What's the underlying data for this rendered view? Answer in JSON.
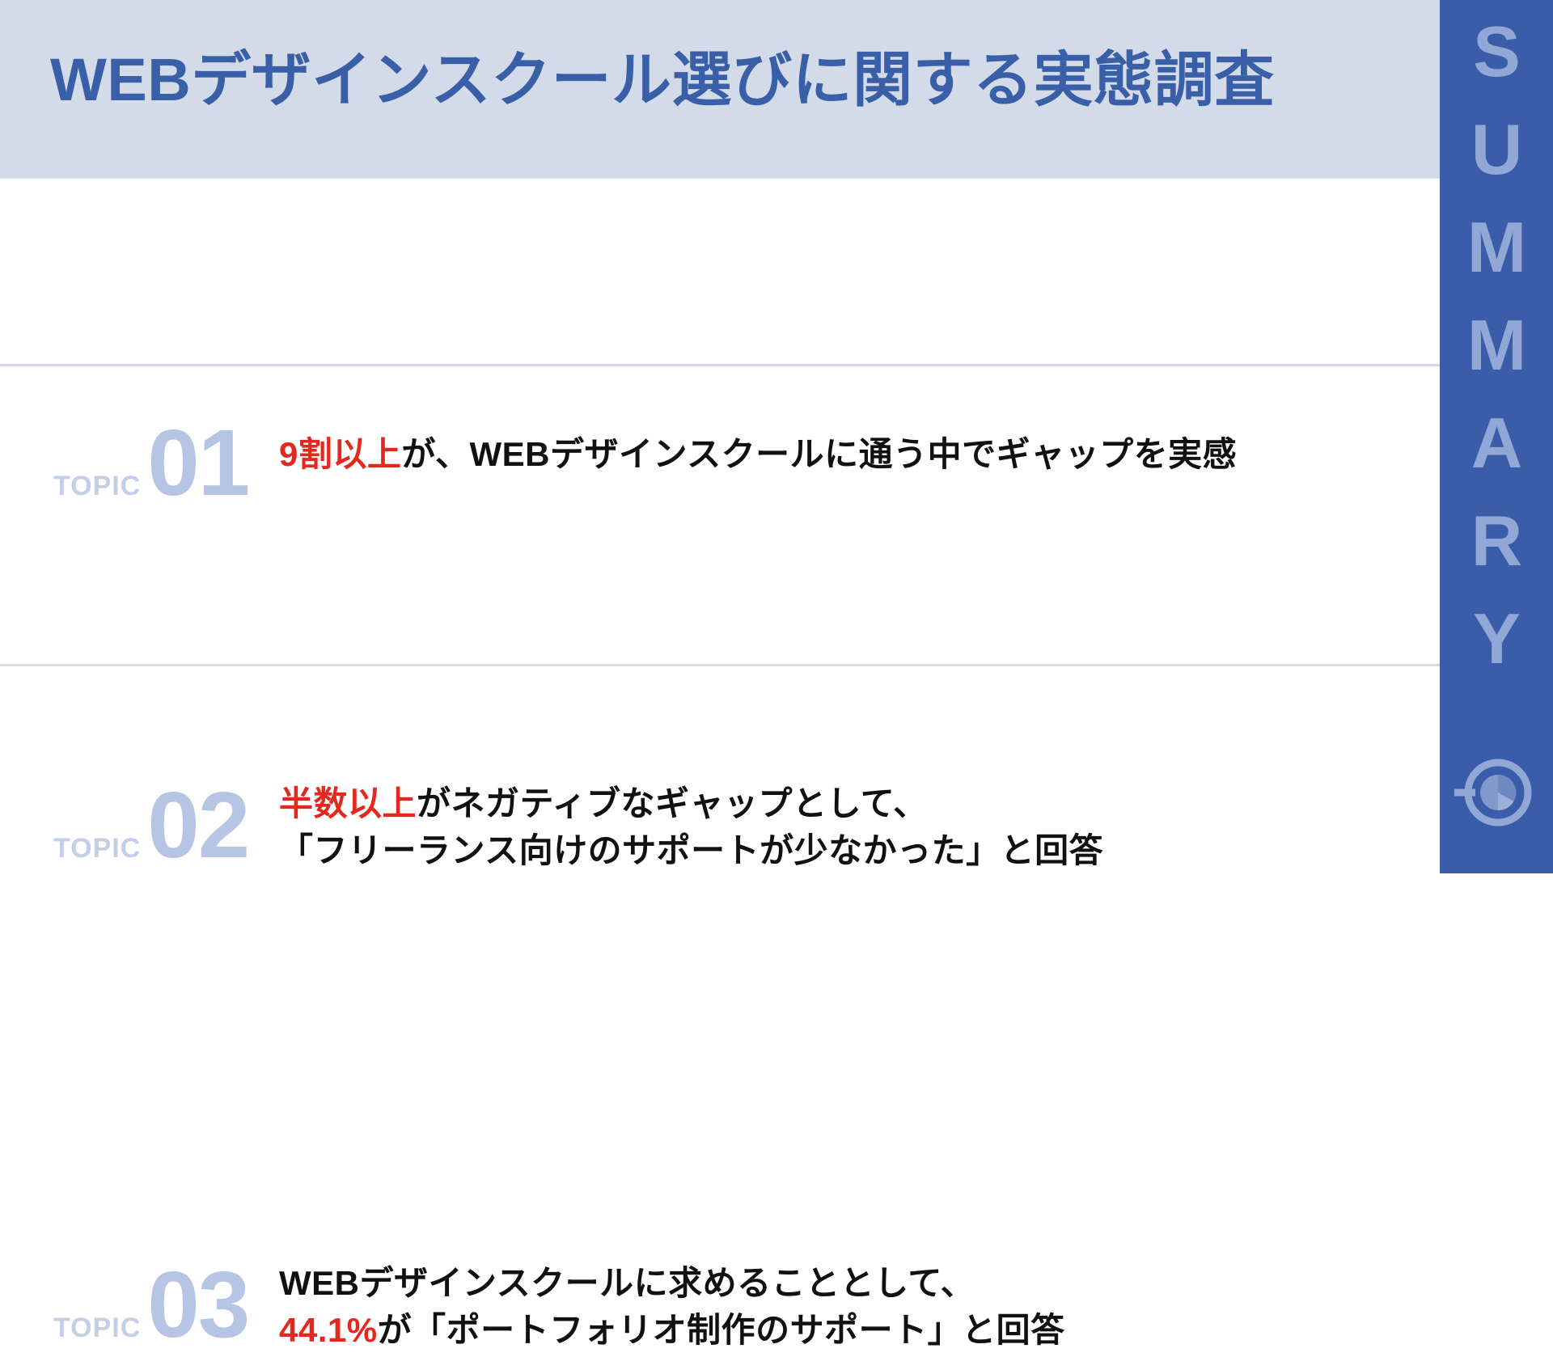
{
  "slide": {
    "title": "WEBデザインスクール選びに関する実態調査",
    "sidebar_label": "SUMMARY",
    "logo_icon": "circular-pie-logo-icon"
  },
  "colors": {
    "header_band": "#d2dbe7",
    "title_blue": "#3a5fa9",
    "sidebar_blue": "#3b5da9",
    "sidebar_label_blue": "#91a7d6",
    "topic_number_blue": "#b6c5e4",
    "topic_word_blue": "#c3cfe8",
    "highlight_red": "#e5271d",
    "body_black": "#111111",
    "divider": "#d2dbe7"
  },
  "topics": [
    {
      "label": "TOPIC",
      "number": "01",
      "lines": [
        {
          "highlight": "9割以上",
          "rest": "が、WEBデザインスクールに通う中でギャップを実感"
        }
      ]
    },
    {
      "label": "TOPIC",
      "number": "02",
      "lines": [
        {
          "highlight": "半数以上",
          "rest": "がネガティブなギャップとして、"
        },
        {
          "highlight": "",
          "rest": "「フリーランス向けのサポートが少なかった」と回答"
        }
      ]
    },
    {
      "label": "TOPIC",
      "number": "03",
      "lines": [
        {
          "highlight": "",
          "rest": "WEBデザインスクールに求めることとして、"
        },
        {
          "highlight": "44.1%",
          "rest": "が「ポートフォリオ制作のサポート」と回答"
        }
      ]
    }
  ]
}
